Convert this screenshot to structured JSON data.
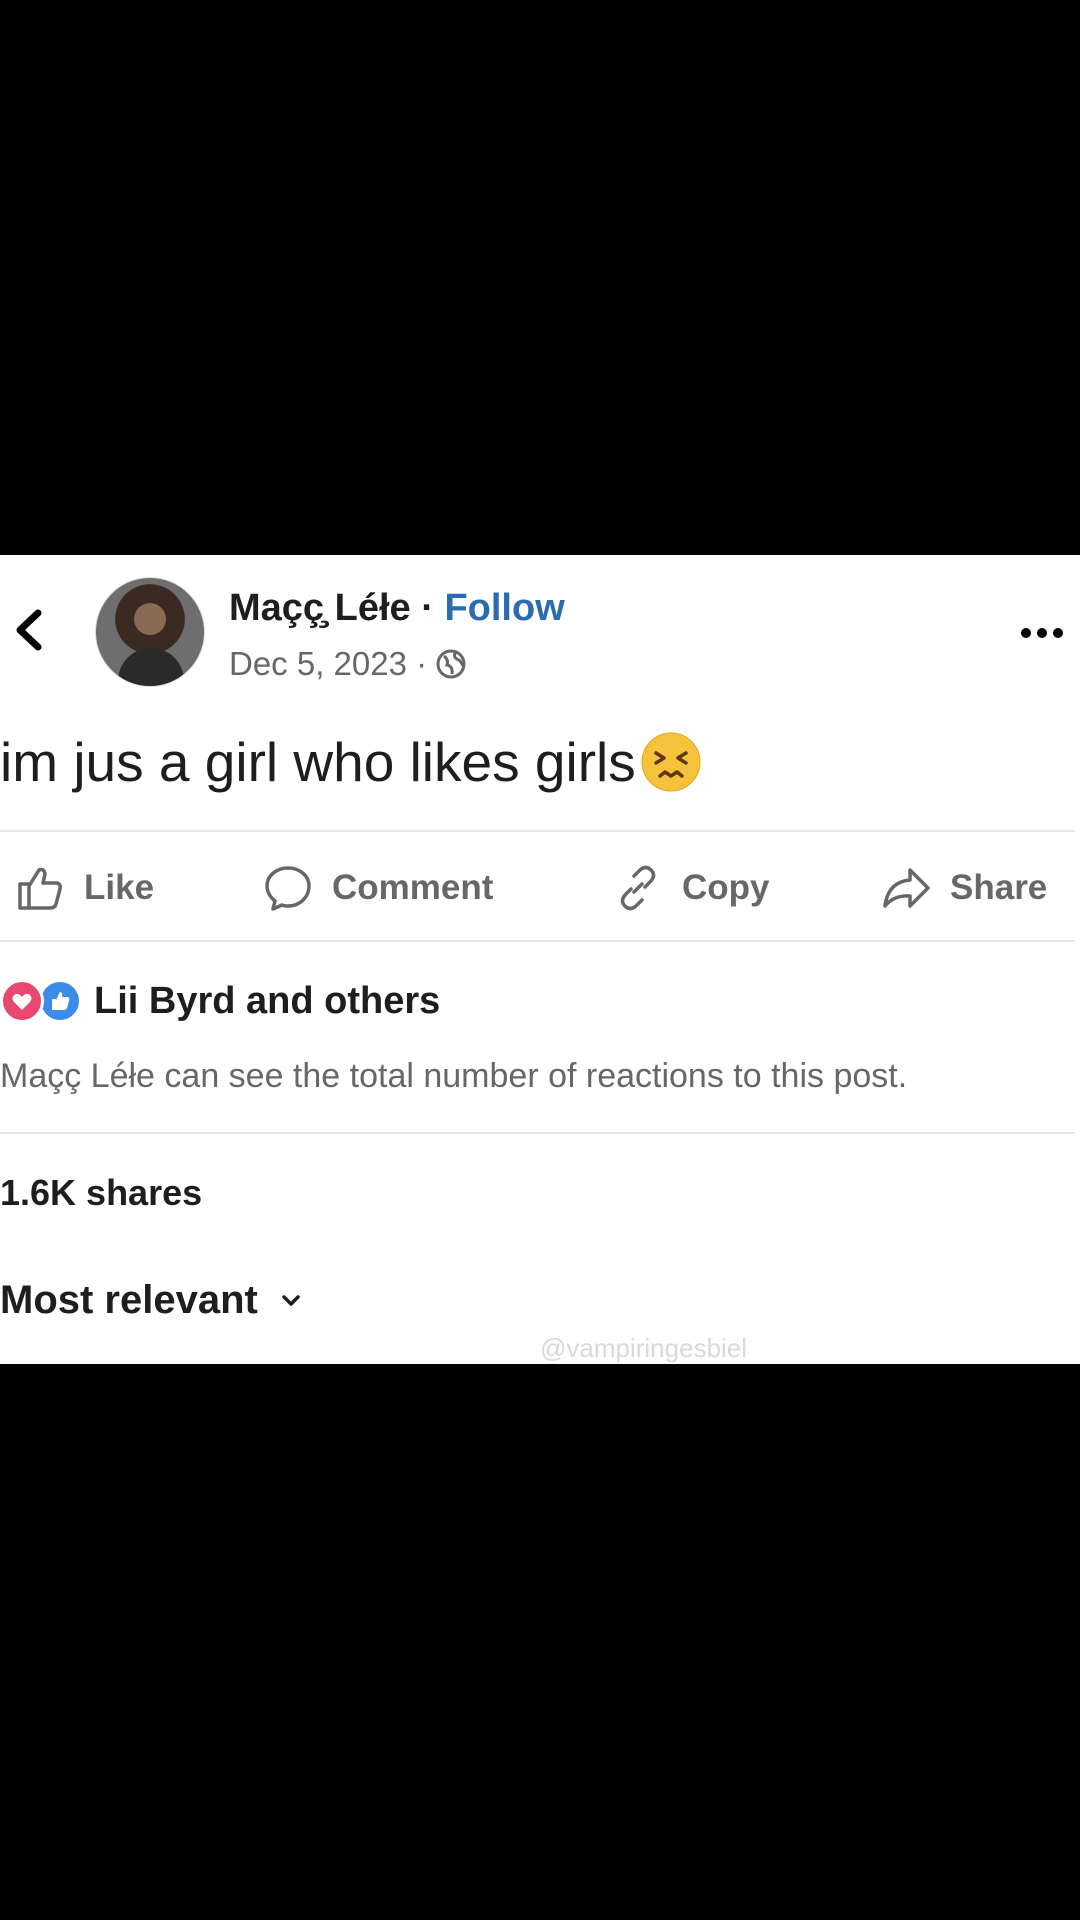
{
  "post": {
    "author": "Maçç̧ Léłe",
    "separator": "·",
    "follow_label": "Follow",
    "date": "Dec 5, 2023 ·",
    "text": "im jus a girl who likes girls"
  },
  "actions": {
    "like": "Like",
    "comment": "Comment",
    "copy": "Copy",
    "share": "Share"
  },
  "reactions": {
    "names": "Lii Byrd and others",
    "note": "Maçç Léłe can see the total number of reactions to this post."
  },
  "shares": "1.6K shares",
  "sort_label": "Most relevant",
  "watermark": "@vampiringesbiel",
  "icons": [
    "back-arrow-icon",
    "globe-icon",
    "more-icon",
    "like-icon",
    "comment-icon",
    "copy-link-icon",
    "share-icon",
    "love-reaction-icon",
    "like-reaction-icon",
    "chevron-down-icon",
    "persevering-face-emoji"
  ],
  "colors": {
    "follow": "#2b6cb0",
    "love": "#e8476f",
    "like": "#3b8ce8",
    "secondary_text": "#65676b"
  }
}
